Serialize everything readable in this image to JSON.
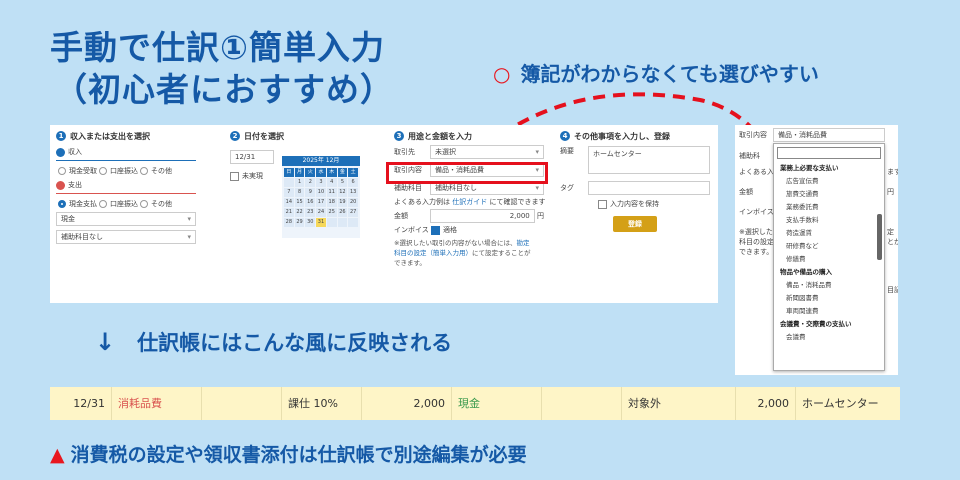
{
  "title": {
    "line1": "手動で仕訳①簡単入力",
    "line2": "（初心者におすすめ）"
  },
  "tip": {
    "mark": "○",
    "text": "簿記がわからなくても選びやすい"
  },
  "form": {
    "step1": {
      "num": "1",
      "label": "収入または支出を選択",
      "income": "収入",
      "income_opts": [
        "現金受取",
        "口座振込",
        "その他"
      ],
      "expense": "支出",
      "expense_opts": [
        "現金支払",
        "口座振込",
        "その他"
      ],
      "account": "現金",
      "sub_account": "補助科目なし"
    },
    "step2": {
      "num": "2",
      "label": "日付を選択",
      "date": "12/31",
      "unpaid": "未実現",
      "cal_title": "2025年 12月",
      "weekdays": [
        "日",
        "月",
        "火",
        "水",
        "木",
        "金",
        "土"
      ],
      "days": [
        "",
        "1",
        "2",
        "3",
        "4",
        "5",
        "6",
        "7",
        "8",
        "9",
        "10",
        "11",
        "12",
        "13",
        "14",
        "15",
        "16",
        "17",
        "18",
        "19",
        "20",
        "21",
        "22",
        "23",
        "24",
        "25",
        "26",
        "27",
        "28",
        "29",
        "30",
        "31",
        "",
        "",
        ""
      ]
    },
    "step3": {
      "num": "3",
      "label": "用途と金額を入力",
      "partner_label": "取引先",
      "partner": "未選択",
      "content_label": "取引内容",
      "content": "備品・消耗品費",
      "sub_label": "補助科目",
      "sub": "補助科目なし",
      "guide_prefix": "よくある入力例は",
      "guide_link": "仕訳ガイド",
      "guide_suffix": "にて確認できます",
      "amount_label": "金額",
      "amount": "2,000",
      "yen": "円",
      "invoice_label": "インボイス",
      "invoice_value": "適格",
      "note1": "※選択したい取引の内容がない場合には、",
      "note_link1": "勘定",
      "note_link2": "科目の設定（簡単入力用）",
      "note2": "にて設定することが",
      "note3": "できます。"
    },
    "step4": {
      "num": "4",
      "label": "その他事項を入力し、登録",
      "memo_label": "摘要",
      "memo": "ホームセンター",
      "tag_label": "タグ",
      "keep_label": "入力内容を保持",
      "register": "登録"
    }
  },
  "dropdown": {
    "label": "取引内容",
    "selected": "備品・消耗品費",
    "bg_texts": [
      "補助科",
      "よくある入",
      "金額",
      "インボイス",
      "※選択した",
      "科目の設定",
      "できます。"
    ],
    "bg_right": [
      "ます",
      "円",
      "定",
      "とが",
      "目記"
    ],
    "items": [
      {
        "text": "業務上必要な支払い",
        "group": true
      },
      {
        "text": "広告宣伝費",
        "group": false
      },
      {
        "text": "旅費交通費",
        "group": false
      },
      {
        "text": "業務委託費",
        "group": false
      },
      {
        "text": "支払手数料",
        "group": false
      },
      {
        "text": "荷造運賃",
        "group": false
      },
      {
        "text": "研修費など",
        "group": false
      },
      {
        "text": "修繕費",
        "group": false
      },
      {
        "text": "物品や備品の購入",
        "group": true
      },
      {
        "text": "備品・消耗品費",
        "group": false
      },
      {
        "text": "新聞図書費",
        "group": false
      },
      {
        "text": "車両関連費",
        "group": false
      },
      {
        "text": "会議費・交際費の支払い",
        "group": true
      },
      {
        "text": "会議費",
        "group": false
      }
    ]
  },
  "reflect": {
    "arrow": "↓",
    "text": "仕訳帳にはこんな風に反映される"
  },
  "journal": {
    "date": "12/31",
    "debit_account": "消耗品費",
    "debit_tax": "課仕 10%",
    "debit_amount": "2,000",
    "credit_account": "現金",
    "credit_tax": "対象外",
    "credit_amount": "2,000",
    "memo": "ホームセンター"
  },
  "warning": {
    "mark": "▲",
    "text": "消費税の設定や領収書添付は仕訳帳で別途編集が必要"
  },
  "colors": {
    "title": "#1559a6",
    "accent_red": "#e8171f",
    "background": "#bfe0f5",
    "journal_bg": "#fef5c7",
    "button": "#d4a017"
  }
}
